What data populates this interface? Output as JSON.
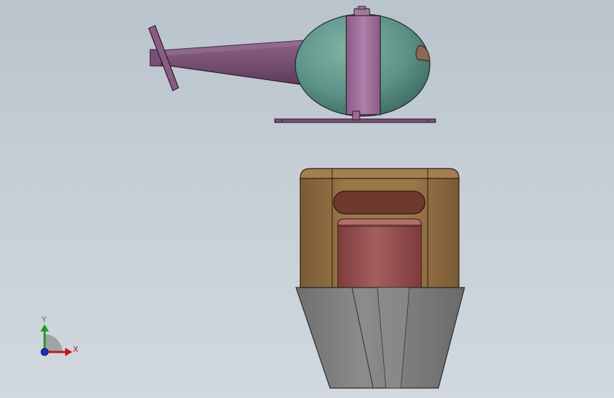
{
  "viewport": {
    "background_top": "#b9c3cc",
    "background_bottom": "#d1d8df"
  },
  "triad": {
    "x_label": "X",
    "y_label": "Y",
    "x_color": "#c0191e",
    "y_color": "#1a9a2a",
    "z_color": "#1d2bbd"
  },
  "model": {
    "helicopter": {
      "cabin_color": "#5e9488",
      "band_color": "#9a6a94",
      "tail_color": "#7a4f75",
      "window_color": "#8a6a55"
    },
    "housing": {
      "body_color": "#8a6a40",
      "slot_color": "#6e3a30",
      "cylinder_color": "#944f4f"
    },
    "base": {
      "color": "#7a7a7a"
    }
  }
}
